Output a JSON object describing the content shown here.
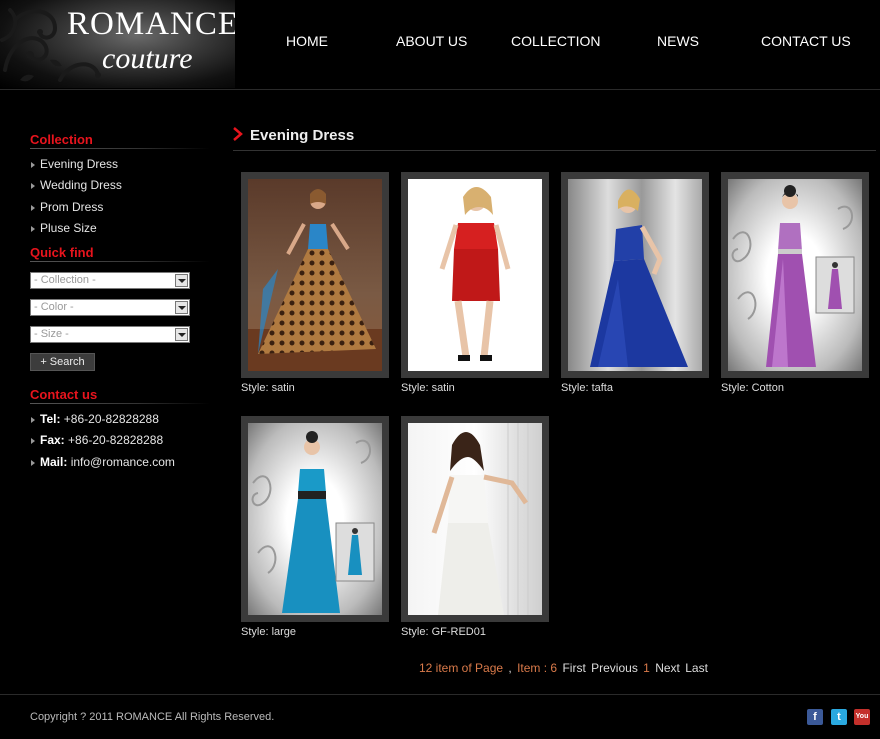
{
  "logo": {
    "line1": "ROMANCE",
    "line2": "couture"
  },
  "nav": [
    {
      "label": "HOME"
    },
    {
      "label": "ABOUT US"
    },
    {
      "label": "COLLECTION"
    },
    {
      "label": "NEWS"
    },
    {
      "label": "CONTACT US"
    }
  ],
  "sidebar": {
    "collection_title": "Collection",
    "collection_items": [
      "Evening Dress",
      "Wedding Dress",
      "Prom Dress",
      "Pluse Size"
    ],
    "quickfind_title": "Quick find",
    "selects": [
      "- Collection -",
      "- Color -",
      "- Size -"
    ],
    "search_label": "+ Search",
    "contact_title": "Contact us",
    "contact": [
      {
        "label": "Tel:",
        "value": "+86-20-82828288"
      },
      {
        "label": "Fax:",
        "value": "+86-20-82828288"
      },
      {
        "label": "Mail:",
        "value": "info@romance.com"
      }
    ]
  },
  "main": {
    "title": "Evening Dress",
    "products": [
      {
        "caption": "Style: satin"
      },
      {
        "caption": "Style: satin"
      },
      {
        "caption": "Style: tafta"
      },
      {
        "caption": "Style: Cotton"
      },
      {
        "caption": "Style: large"
      },
      {
        "caption": "Style: GF-RED01"
      }
    ]
  },
  "pager": {
    "per_page": "12 item of Page",
    "sep": ",",
    "items": "Item : 6",
    "first": "First",
    "previous": "Previous",
    "current": "1",
    "next": "Next",
    "last": "Last"
  },
  "footer": {
    "copyright": "Copyright ? 2011 ROMANCE All Rights Reserved.",
    "social": [
      {
        "icon": "facebook-icon",
        "glyph": "f",
        "color": "#3b5998"
      },
      {
        "icon": "twitter-icon",
        "glyph": "t",
        "color": "#2aa9e0"
      },
      {
        "icon": "youtube-icon",
        "glyph": "You",
        "color": "#c4302b"
      }
    ]
  },
  "colors": {
    "accent_red": "#e8141d",
    "pager_orange": "#d97a4a"
  }
}
